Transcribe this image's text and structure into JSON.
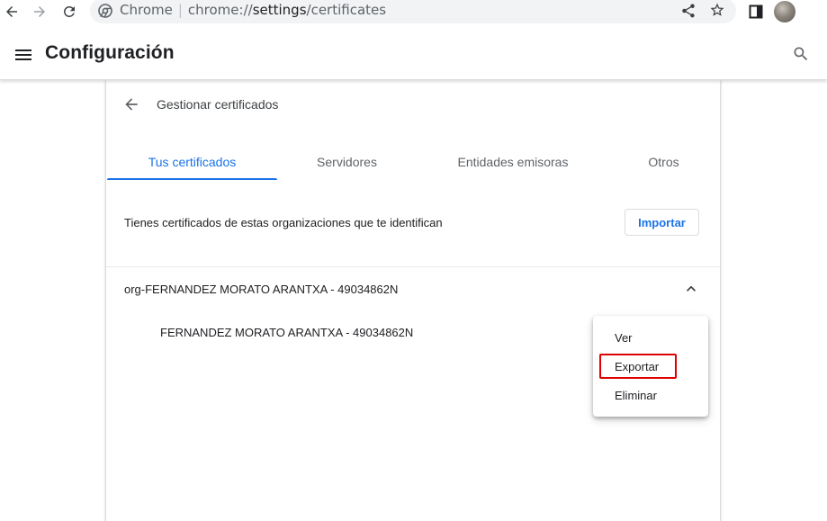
{
  "browser": {
    "omnibox": {
      "site_label": "Chrome",
      "url_scheme": "chrome://",
      "url_host": "settings",
      "url_path": "/certificates"
    },
    "icons": {
      "back": "arrow-back-icon",
      "forward": "arrow-forward-icon",
      "reload": "reload-icon",
      "site": "chrome-icon",
      "share": "share-icon",
      "bookmark": "star-icon",
      "side_panel": "side-panel-icon",
      "profile": "avatar"
    }
  },
  "header": {
    "title": "Configuración"
  },
  "subpage": {
    "title": "Gestionar certificados",
    "tabs": [
      {
        "label": "Tus certificados",
        "active": true
      },
      {
        "label": "Servidores",
        "active": false
      },
      {
        "label": "Entidades emisoras",
        "active": false
      },
      {
        "label": "Otros",
        "active": false
      }
    ],
    "description": "Tienes certificados de estas organizaciones que te identifican",
    "import_label": "Importar",
    "organization": "org-FERNANDEZ MORATO ARANTXA - 49034862N",
    "certificate": "FERNANDEZ MORATO ARANTXA - 49034862N"
  },
  "context_menu": {
    "items": [
      {
        "label": "Ver"
      },
      {
        "label": "Exportar",
        "highlighted": true
      },
      {
        "label": "Eliminar"
      }
    ]
  },
  "colors": {
    "accent": "#1a73e8",
    "highlight": "#e00000"
  }
}
